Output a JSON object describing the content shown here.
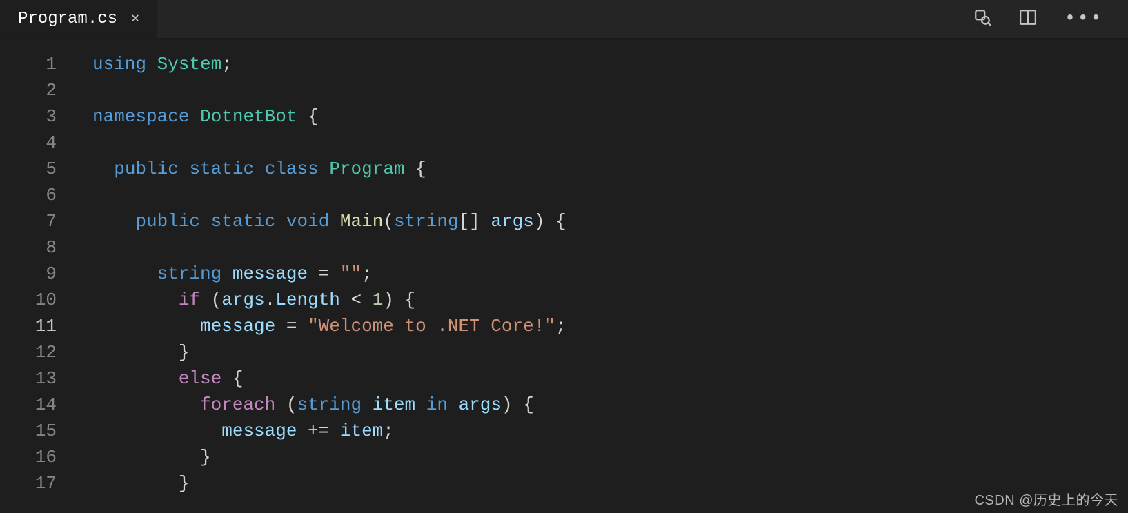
{
  "tab": {
    "filename": "Program.cs"
  },
  "actions": {
    "find": "find-icon",
    "split": "split-editor-icon",
    "more": "more-icon"
  },
  "editor": {
    "current_line_index": 10,
    "lines": [
      {
        "num": 1,
        "indent": 0,
        "tokens": [
          {
            "t": "using",
            "c": "kw"
          },
          {
            "t": " "
          },
          {
            "t": "System",
            "c": "ns"
          },
          {
            "t": ";",
            "c": "punc"
          }
        ]
      },
      {
        "num": 2,
        "indent": 0,
        "tokens": []
      },
      {
        "num": 3,
        "indent": 0,
        "tokens": [
          {
            "t": "namespace",
            "c": "kw"
          },
          {
            "t": " "
          },
          {
            "t": "DotnetBot",
            "c": "ns"
          },
          {
            "t": " {",
            "c": "punc"
          }
        ]
      },
      {
        "num": 4,
        "indent": 0,
        "tokens": []
      },
      {
        "num": 5,
        "indent": 1,
        "tokens": [
          {
            "t": "public",
            "c": "mod"
          },
          {
            "t": " "
          },
          {
            "t": "static",
            "c": "mod"
          },
          {
            "t": " "
          },
          {
            "t": "class",
            "c": "mod"
          },
          {
            "t": " "
          },
          {
            "t": "Program",
            "c": "type"
          },
          {
            "t": " {",
            "c": "punc"
          }
        ]
      },
      {
        "num": 6,
        "indent": 0,
        "tokens": []
      },
      {
        "num": 7,
        "indent": 2,
        "tokens": [
          {
            "t": "public",
            "c": "mod"
          },
          {
            "t": " "
          },
          {
            "t": "static",
            "c": "mod"
          },
          {
            "t": " "
          },
          {
            "t": "void",
            "c": "mod"
          },
          {
            "t": " "
          },
          {
            "t": "Main",
            "c": "func"
          },
          {
            "t": "(",
            "c": "punc"
          },
          {
            "t": "string",
            "c": "kw"
          },
          {
            "t": "[] ",
            "c": "punc"
          },
          {
            "t": "args",
            "c": "var"
          },
          {
            "t": ") {",
            "c": "punc"
          }
        ]
      },
      {
        "num": 8,
        "indent": 0,
        "tokens": []
      },
      {
        "num": 9,
        "indent": 3,
        "tokens": [
          {
            "t": "string",
            "c": "kw"
          },
          {
            "t": " "
          },
          {
            "t": "message",
            "c": "var"
          },
          {
            "t": " = ",
            "c": "op"
          },
          {
            "t": "\"\"",
            "c": "str"
          },
          {
            "t": ";",
            "c": "punc"
          }
        ]
      },
      {
        "num": 10,
        "indent": 4,
        "tokens": [
          {
            "t": "if",
            "c": "ctrl"
          },
          {
            "t": " (",
            "c": "punc"
          },
          {
            "t": "args",
            "c": "var"
          },
          {
            "t": ".",
            "c": "punc"
          },
          {
            "t": "Length",
            "c": "var"
          },
          {
            "t": " < ",
            "c": "op"
          },
          {
            "t": "1",
            "c": "num"
          },
          {
            "t": ") {",
            "c": "punc"
          }
        ]
      },
      {
        "num": 11,
        "indent": 5,
        "tokens": [
          {
            "t": "message",
            "c": "var"
          },
          {
            "t": " = ",
            "c": "op"
          },
          {
            "t": "\"Welcome to .NET Core!\"",
            "c": "str"
          },
          {
            "t": ";",
            "c": "punc"
          }
        ]
      },
      {
        "num": 12,
        "indent": 4,
        "tokens": [
          {
            "t": "}",
            "c": "punc"
          }
        ]
      },
      {
        "num": 13,
        "indent": 4,
        "tokens": [
          {
            "t": "else",
            "c": "ctrl"
          },
          {
            "t": " {",
            "c": "punc"
          }
        ]
      },
      {
        "num": 14,
        "indent": 5,
        "tokens": [
          {
            "t": "foreach",
            "c": "ctrl"
          },
          {
            "t": " (",
            "c": "punc"
          },
          {
            "t": "string",
            "c": "kw"
          },
          {
            "t": " "
          },
          {
            "t": "item",
            "c": "var"
          },
          {
            "t": " "
          },
          {
            "t": "in",
            "c": "kw"
          },
          {
            "t": " "
          },
          {
            "t": "args",
            "c": "var"
          },
          {
            "t": ") {",
            "c": "punc"
          }
        ]
      },
      {
        "num": 15,
        "indent": 6,
        "tokens": [
          {
            "t": "message",
            "c": "var"
          },
          {
            "t": " += ",
            "c": "op"
          },
          {
            "t": "item",
            "c": "var"
          },
          {
            "t": ";",
            "c": "punc"
          }
        ]
      },
      {
        "num": 16,
        "indent": 5,
        "tokens": [
          {
            "t": "}",
            "c": "punc"
          }
        ]
      },
      {
        "num": 17,
        "indent": 4,
        "tokens": [
          {
            "t": "}",
            "c": "punc"
          }
        ]
      }
    ]
  },
  "watermark": "CSDN @历史上的今天"
}
